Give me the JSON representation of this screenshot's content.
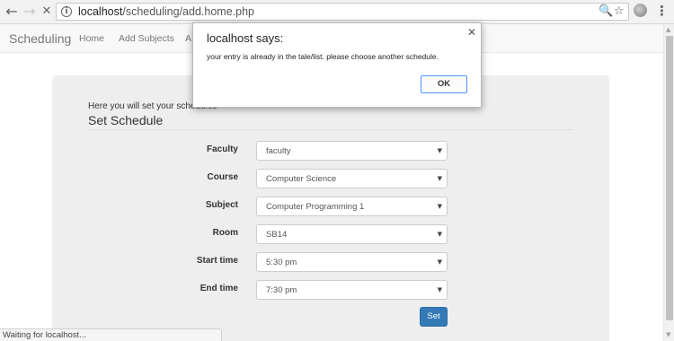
{
  "browser": {
    "back_icon": "←",
    "forward_icon": "→",
    "stop_icon": "✕",
    "info_icon": "i",
    "url_host": "localhost",
    "url_path": "/scheduling/add.home.php",
    "zoom_icon": "🔍",
    "star_icon": "☆",
    "menu_icon": "⋮"
  },
  "navbar": {
    "brand": "Scheduling",
    "links": [
      "Home",
      "Add Subjects",
      "A"
    ]
  },
  "panel": {
    "subtitle": "Here you will set your schedules",
    "title": "Set Schedule",
    "fields": [
      {
        "label": "Faculty",
        "value": "faculty"
      },
      {
        "label": "Course",
        "value": "Computer Science"
      },
      {
        "label": "Subject",
        "value": "Computer Programming 1"
      },
      {
        "label": "Room",
        "value": "SB14"
      },
      {
        "label": "Start time",
        "value": "5:30 pm"
      },
      {
        "label": "End time",
        "value": "7:30 pm"
      }
    ],
    "caret": "▼",
    "submit_label": "Set"
  },
  "dialog": {
    "title": "localhost says:",
    "message": "your entry is already in the tale/list. please choose another schedule.",
    "ok_label": "OK",
    "close_icon": "✕"
  },
  "status_text": "Waiting for localhost...",
  "scrollbar": {
    "up_icon": "▲",
    "down_icon": "▼"
  }
}
